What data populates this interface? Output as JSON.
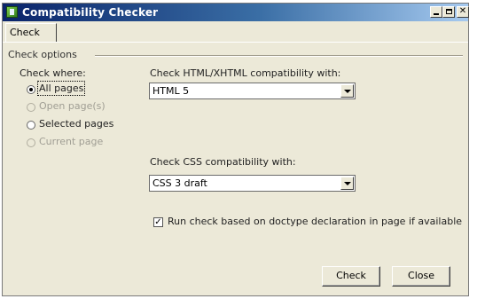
{
  "window": {
    "title": "Compatibility Checker"
  },
  "tabs": [
    {
      "label": "Check"
    }
  ],
  "group": {
    "label": "Check options"
  },
  "check_where": {
    "label": "Check where:",
    "options": [
      {
        "label": "All pages",
        "selected": true,
        "enabled": true
      },
      {
        "label": "Open page(s)",
        "selected": false,
        "enabled": false
      },
      {
        "label": "Selected pages",
        "selected": false,
        "enabled": true
      },
      {
        "label": "Current page",
        "selected": false,
        "enabled": false
      }
    ]
  },
  "html_compat": {
    "label": "Check HTML/XHTML compatibility with:",
    "value": "HTML 5"
  },
  "css_compat": {
    "label": "Check CSS compatibility with:",
    "value": "CSS 3 draft"
  },
  "doctype_check": {
    "label": "Run check based on doctype declaration in page if available",
    "checked": true
  },
  "buttons": {
    "check": "Check",
    "close": "Close"
  }
}
